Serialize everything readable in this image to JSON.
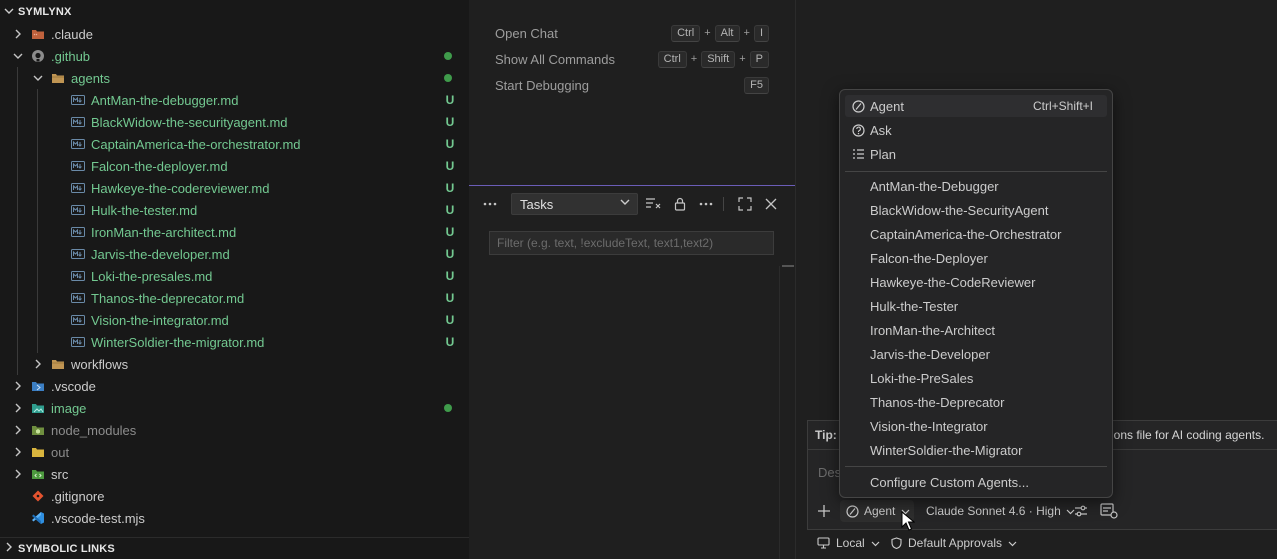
{
  "explorer": {
    "section_title": "SYMLYNX",
    "bottom_section_title": "SYMBOLIC LINKS",
    "items": [
      {
        "label": ".claude",
        "status": ""
      },
      {
        "label": ".github",
        "status": ""
      },
      {
        "label": "agents",
        "status": ""
      },
      {
        "label": "AntMan-the-debugger.md",
        "status": "U"
      },
      {
        "label": "BlackWidow-the-securityagent.md",
        "status": "U"
      },
      {
        "label": "CaptainAmerica-the-orchestrator.md",
        "status": "U"
      },
      {
        "label": "Falcon-the-deployer.md",
        "status": "U"
      },
      {
        "label": "Hawkeye-the-codereviewer.md",
        "status": "U"
      },
      {
        "label": "Hulk-the-tester.md",
        "status": "U"
      },
      {
        "label": "IronMan-the-architect.md",
        "status": "U"
      },
      {
        "label": "Jarvis-the-developer.md",
        "status": "U"
      },
      {
        "label": "Loki-the-presales.md",
        "status": "U"
      },
      {
        "label": "Thanos-the-deprecator.md",
        "status": "U"
      },
      {
        "label": "Vision-the-integrator.md",
        "status": "U"
      },
      {
        "label": "WinterSoldier-the-migrator.md",
        "status": "U"
      },
      {
        "label": "workflows",
        "status": ""
      },
      {
        "label": ".vscode",
        "status": ""
      },
      {
        "label": "image",
        "status": ""
      },
      {
        "label": "node_modules",
        "status": ""
      },
      {
        "label": "out",
        "status": ""
      },
      {
        "label": "src",
        "status": ""
      },
      {
        "label": ".gitignore",
        "status": ""
      },
      {
        "label": ".vscode-test.mjs",
        "status": ""
      }
    ],
    "colors": {
      "untracked": "#73c991",
      "modified_dot": "#3f9b4b",
      "ignored": "#8c8c8c",
      "default": "#cccccc"
    }
  },
  "welcome": {
    "commands": [
      {
        "label": "Open Chat",
        "keys": [
          "Ctrl",
          "Alt",
          "I"
        ]
      },
      {
        "label": "Show All Commands",
        "keys": [
          "Ctrl",
          "Shift",
          "P"
        ]
      },
      {
        "label": "Start Debugging",
        "keys": [
          "F5"
        ]
      }
    ],
    "plus": "+"
  },
  "panel": {
    "task_select": "Tasks",
    "filter_placeholder": "Filter (e.g. text, !excludeText, text1,text2)"
  },
  "chat": {
    "tip_label": "Tip:",
    "tip_text": "ions file for AI coding agents.",
    "input_placeholder": "Des",
    "mode_button": "Agent",
    "model_button": "Claude Sonnet 4.6 · High",
    "location": "Local",
    "approvals": "Default Approvals"
  },
  "agent_menu": {
    "modes": [
      {
        "label": "Agent",
        "shortcut": "Ctrl+Shift+I",
        "icon": "agent-icon"
      },
      {
        "label": "Ask",
        "shortcut": "",
        "icon": "ask-icon"
      },
      {
        "label": "Plan",
        "shortcut": "",
        "icon": "plan-icon"
      }
    ],
    "custom_agents": [
      "AntMan-the-Debugger",
      "BlackWidow-the-SecurityAgent",
      "CaptainAmerica-the-Orchestrator",
      "Falcon-the-Deployer",
      "Hawkeye-the-CodeReviewer",
      "Hulk-the-Tester",
      "IronMan-the-Architect",
      "Jarvis-the-Developer",
      "Loki-the-PreSales",
      "Thanos-the-Deprecator",
      "Vision-the-Integrator",
      "WinterSoldier-the-Migrator"
    ],
    "configure": "Configure Custom Agents..."
  }
}
